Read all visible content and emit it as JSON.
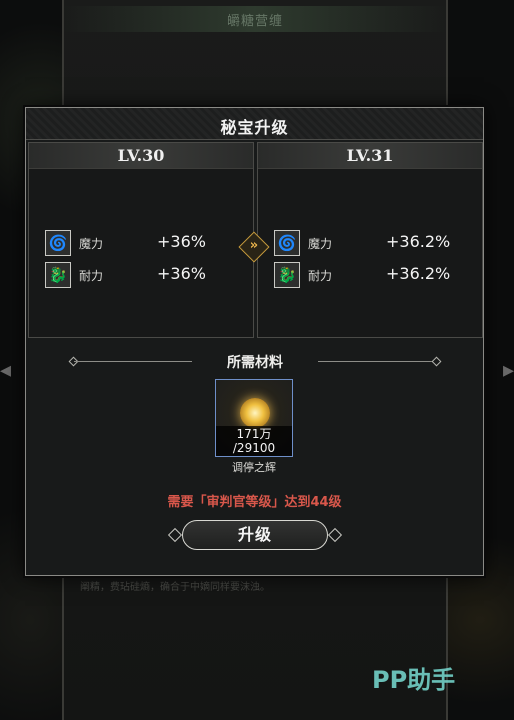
{
  "background": {
    "title": "皭糖营缠",
    "footer_text": "阐精，费玷硅熵，确合于中嫡同样要沫浊。"
  },
  "dialog": {
    "title": "秘宝升级",
    "current": {
      "level": "LV.30",
      "stats": [
        {
          "icon": "swirl-icon",
          "name": "魔力",
          "value": "+36%"
        },
        {
          "icon": "dragon-icon",
          "name": "耐力",
          "value": "+36%"
        }
      ]
    },
    "next": {
      "level": "LV.31",
      "stats": [
        {
          "icon": "swirl-icon",
          "name": "魔力",
          "value": "+36.2%"
        },
        {
          "icon": "dragon-icon",
          "name": "耐力",
          "value": "+36.2%"
        }
      ]
    },
    "arrow_glyph": "»",
    "materials": {
      "title": "所需材料",
      "item": {
        "name": "调停之辉",
        "owned": "171万",
        "required": "/29100"
      }
    },
    "requirement": "需要「审判官等级」达到44级",
    "upgrade_button": "升级"
  },
  "nav": {
    "left_arrow": "◂",
    "right_arrow": "▸"
  },
  "watermark": "PP助手",
  "colors": {
    "requirement_red": "#d8574b",
    "accent_gold": "#e7b24b",
    "item_border_blue": "#6e8fc9",
    "watermark_teal": "#78dcd2"
  }
}
